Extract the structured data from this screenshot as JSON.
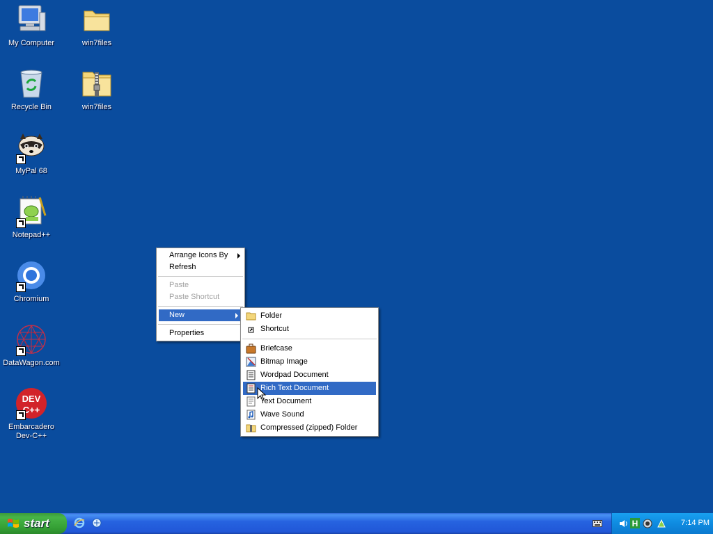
{
  "desktop": {
    "icons": [
      {
        "label": "My Computer",
        "icon": "my-computer-icon"
      },
      {
        "label": "win7files",
        "icon": "folder-icon"
      },
      {
        "label": "Recycle Bin",
        "icon": "recycle-bin-icon"
      },
      {
        "label": "win7files",
        "icon": "zip-folder-icon"
      },
      {
        "label": "MyPal 68",
        "icon": "mypal-icon"
      },
      {
        "label": "Notepad++",
        "icon": "notepadpp-icon"
      },
      {
        "label": "Chromium",
        "icon": "chromium-icon"
      },
      {
        "label": "DataWagon.com",
        "icon": "datawagon-icon"
      },
      {
        "label": "Embarcadero\nDev-C++",
        "icon": "devcpp-icon"
      }
    ]
  },
  "context_menu": {
    "items": [
      {
        "label": "Arrange Icons By",
        "has_submenu": true
      },
      {
        "label": "Refresh"
      },
      {
        "label": "Paste",
        "disabled": true
      },
      {
        "label": "Paste Shortcut",
        "disabled": true
      },
      {
        "label": "New",
        "has_submenu": true,
        "active": true
      },
      {
        "label": "Properties"
      }
    ]
  },
  "new_submenu": {
    "items": [
      {
        "label": "Folder",
        "icon": "folder-icon",
        "underline": "F"
      },
      {
        "label": "Shortcut",
        "icon": "shortcut-icon",
        "underline": "S"
      },
      {
        "label": "Briefcase",
        "icon": "briefcase-icon"
      },
      {
        "label": "Bitmap Image",
        "icon": "bitmap-icon"
      },
      {
        "label": "Wordpad Document",
        "icon": "wordpad-icon"
      },
      {
        "label": "Rich Text Document",
        "icon": "rtf-icon",
        "active": true
      },
      {
        "label": "Text Document",
        "icon": "text-document-icon"
      },
      {
        "label": "Wave Sound",
        "icon": "wave-sound-icon"
      },
      {
        "label": "Compressed (zipped) Folder",
        "icon": "zip-folder-icon"
      }
    ]
  },
  "taskbar": {
    "start_label": "start",
    "quick_launch": [
      "internet-explorer-icon",
      "outlook-express-icon"
    ],
    "tray_icons": [
      "keyboard-icon",
      "volume-icon",
      "h-icon",
      "security-icon",
      "network-icon"
    ],
    "clock": "7:14 PM"
  },
  "colors": {
    "desktop": "#0a4c9e",
    "menu_highlight": "#316ac5",
    "start_green": "#3c9a3c",
    "taskbar_blue": "#2157d7"
  }
}
